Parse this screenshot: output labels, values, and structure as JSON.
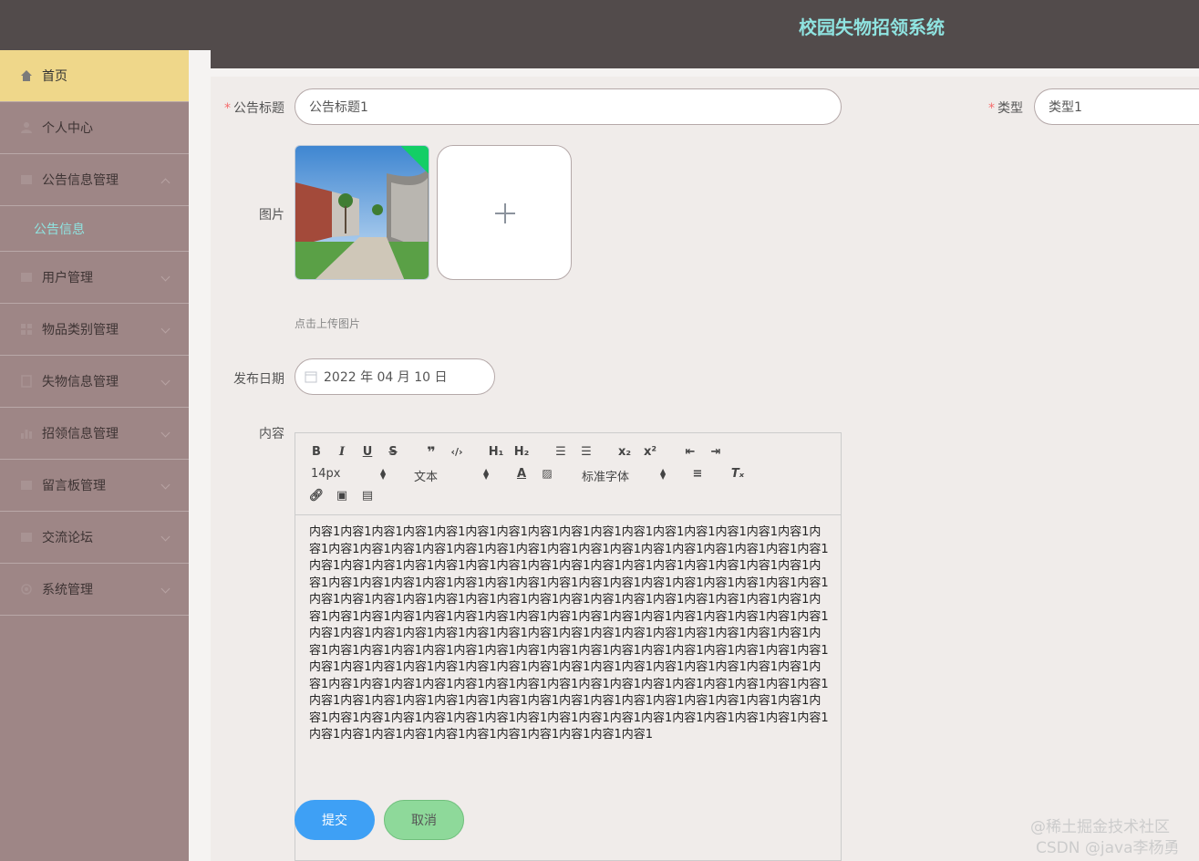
{
  "header": {
    "title": "校园失物招领系统"
  },
  "sidebar": {
    "items": [
      {
        "label": "首页",
        "icon": "home-icon"
      },
      {
        "label": "个人中心",
        "icon": "user-icon"
      },
      {
        "label": "公告信息管理",
        "icon": "grid-icon"
      },
      {
        "label": "公告信息"
      },
      {
        "label": "用户管理",
        "icon": "grid-icon"
      },
      {
        "label": "物品类别管理",
        "icon": "grid-icon"
      },
      {
        "label": "失物信息管理",
        "icon": "doc-icon"
      },
      {
        "label": "招领信息管理",
        "icon": "chart-icon"
      },
      {
        "label": "留言板管理",
        "icon": "grid-icon"
      },
      {
        "label": "交流论坛",
        "icon": "grid-icon"
      },
      {
        "label": "系统管理",
        "icon": "gear-icon"
      }
    ]
  },
  "form": {
    "title_label": "公告标题",
    "title_value": "公告标题1",
    "type_label": "类型",
    "type_value": "类型1",
    "image_label": "图片",
    "upload_tip": "点击上传图片",
    "date_label": "发布日期",
    "date_value": "2022 年 04 月 10 日",
    "content_label": "内容",
    "submit_label": "提交",
    "cancel_label": "取消"
  },
  "editor": {
    "font_size": "14px",
    "text_type": "文本",
    "font_family": "标准字体",
    "content": "内容1内容1内容1内容1内容1内容1内容1内容1内容1内容1内容1内容1内容1内容1内容1内容1内容1内容1内容1内容1内容1内容1内容1内容1内容1内容1内容1内容1内容1内容1内容1内容1内容1内容1内容1内容1内容1内容1内容1内容1内容1内容1内容1内容1内容1内容1内容1内容1内容1内容1内容1内容1内容1内容1内容1内容1内容1内容1内容1内容1内容1内容1内容1内容1内容1内容1内容1内容1内容1内容1内容1内容1内容1内容1内容1内容1内容1内容1内容1内容1内容1内容1内容1内容1内容1内容1内容1内容1内容1内容1内容1内容1内容1内容1内容1内容1内容1内容1内容1内容1内容1内容1内容1内容1内容1内容1内容1内容1内容1内容1内容1内容1内容1内容1内容1内容1内容1内容1内容1内容1内容1内容1内容1内容1内容1内容1内容1内容1内容1内容1内容1内容1内容1内容1内容1内容1内容1内容1内容1内容1内容1内容1内容1内容1内容1内容1内容1内容1内容1内容1内容1内容1内容1内容1内容1内容1内容1内容1内容1内容1内容1内容1内容1内容1内容1内容1内容1内容1内容1内容1内容1内容1内容1内容1内容1内容1内容1内容1内容1内容1内容1内容1内容1内容1内容1内容1内容1内容1内容1内容1内容1内容1内容1内容1内容1内容1内容1内容1内容1内容1内容1内容1内容1内容1内容1内容1内容1内容1内容1"
  },
  "watermark": {
    "line1": "@稀土掘金技术社区",
    "line2": "CSDN @java李杨勇"
  },
  "colors": {
    "header_bg": "#524b4b",
    "sidebar_bg": "#9e8686",
    "active_bg": "#efd78a",
    "accent": "#8fe3e0",
    "submit": "#3ea0f5",
    "cancel": "#8ed99a"
  }
}
